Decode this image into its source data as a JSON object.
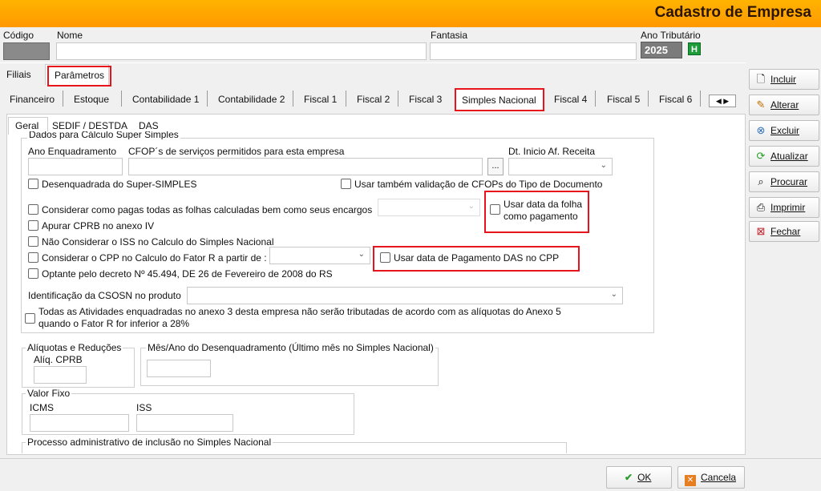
{
  "window": {
    "title": "Cadastro de Empresa"
  },
  "header": {
    "codigo_label": "Código",
    "nome_label": "Nome",
    "fantasia_label": "Fantasia",
    "ano_label": "Ano Tributário",
    "ano_value": "2025",
    "ano_button": "H"
  },
  "top_tabs": [
    "Filiais",
    "Parâmetros"
  ],
  "sub_tabs": [
    "Financeiro",
    "Estoque",
    "Contabilidade 1",
    "Contabilidade 2",
    "Fiscal 1",
    "Fiscal 2",
    "Fiscal 3",
    "Simples Nacional",
    "Fiscal 4",
    "Fiscal 5",
    "Fiscal 6"
  ],
  "inner_tabs": [
    "Geral",
    "SEDIF / DESTDA",
    "DAS"
  ],
  "form": {
    "group_title": "Dados para Cálculo Super Simples",
    "ano_enquadramento": "Ano Enquadramento",
    "cfop_label": "CFOP´s de serviços permitidos para esta empresa",
    "cfop_button": "...",
    "dt_inicio": "Dt. Inicio Af. Receita",
    "desenquadrada": "Desenquadrada do Super-SIMPLES",
    "usar_validacao": "Usar também validação de CFOPs do Tipo de Documento",
    "considerar_pagas": "Considerar como pagas todas as folhas calculadas bem como seus encargos",
    "usar_data_folha_1": "Usar data da folha",
    "usar_data_folha_2": "como pagamento",
    "apurar_cprb": "Apurar CPRB no anexo IV",
    "nao_considerar_iss": "Não Considerar o ISS no Calculo do Simples Nacional",
    "considerar_cpp": "Considerar o CPP no Calculo do Fator R a partir de :",
    "usar_data_das": "Usar data de Pagamento DAS no CPP",
    "optante_decreto": "Optante pelo decreto  Nº 45.494, DE 26 de Fevereiro de 2008 do RS",
    "identificacao_csosn": "Identificação da CSOSN no produto",
    "todas_atividades_1": "Todas as Atividades enquadradas no anexo 3 desta empresa não serão tributadas de acordo com as alíquotas do Anexo 5",
    "todas_atividades_2": "quando o Fator R for inferior a 28%"
  },
  "aliquotas": {
    "title": "Alíquotas e Reduções",
    "cprb_label": "Alíq. CPRB"
  },
  "desenquadramento": {
    "title": "Mês/Ano do Desenquadramento (Último mês no Simples Nacional)"
  },
  "valor_fixo": {
    "title": "Valor Fixo",
    "icms_label": "ICMS",
    "iss_label": "ISS"
  },
  "processo": {
    "title": "Processo administrativo de inclusão no Simples Nacional"
  },
  "side_buttons": [
    {
      "label": "Incluir",
      "icon": "document-icon"
    },
    {
      "label": "Alterar",
      "icon": "pencil-icon"
    },
    {
      "label": "Excluir",
      "icon": "delete-icon"
    },
    {
      "label": "Atualizar",
      "icon": "refresh-icon"
    },
    {
      "label": "Procurar",
      "icon": "binoculars-icon"
    },
    {
      "label": "Imprimir",
      "icon": "printer-icon"
    },
    {
      "label": "Fechar",
      "icon": "close-window-icon"
    }
  ],
  "bottom_buttons": {
    "ok": "OK",
    "cancel": "Cancela"
  },
  "colors": {
    "titlebar": "#ff9900",
    "highlight": "#e8141c",
    "ok_check": "#2a9d2a",
    "cancel_icon": "#e67e22"
  }
}
